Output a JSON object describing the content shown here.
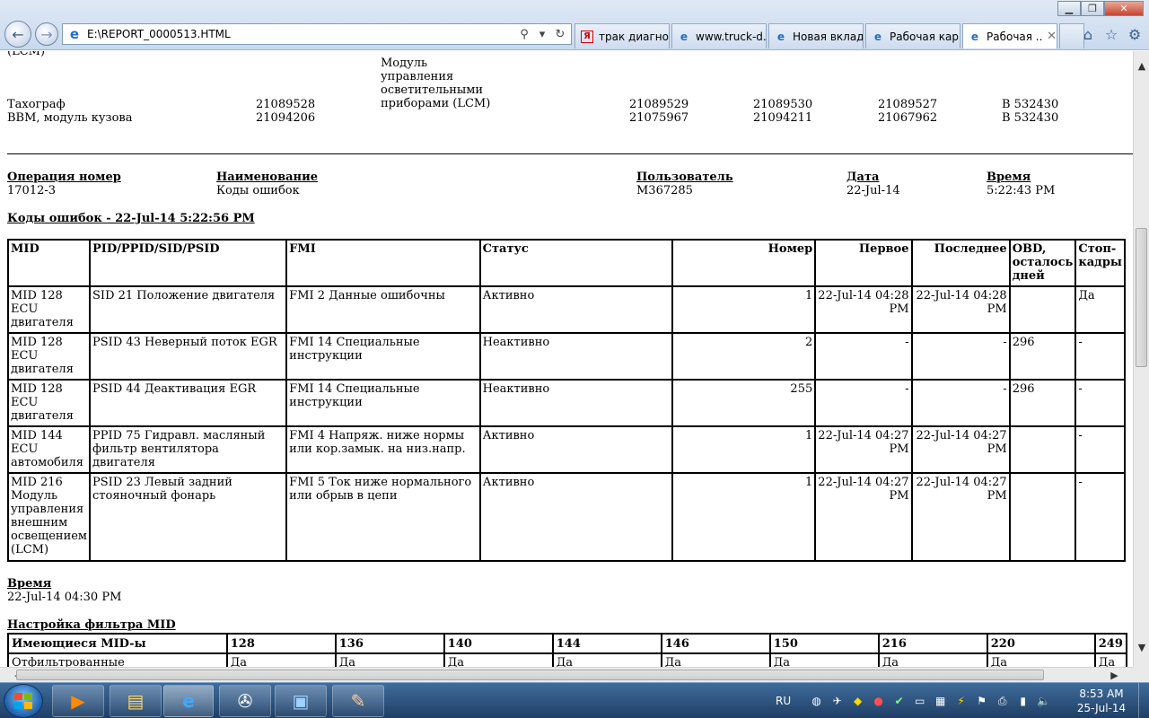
{
  "browser": {
    "address": "E:\\REPORT_0000513.HTML",
    "tabs": [
      {
        "label": "трак диагно...",
        "icon": "yandex-icon",
        "active": false
      },
      {
        "label": "www.truck-d...",
        "icon": "ie-icon",
        "active": false
      },
      {
        "label": "Новая вклад...",
        "icon": "ie-icon",
        "active": false
      },
      {
        "label": "Рабочая кар...",
        "icon": "ie-icon",
        "active": false
      },
      {
        "label": "Рабочая ...",
        "icon": "ie-icon",
        "active": true
      }
    ]
  },
  "report": {
    "lcm_continuation": "(LCM)",
    "lcm_description": "Модуль управления осветительными приборами (LCM)",
    "components": [
      {
        "name": "Тахограф",
        "part": "21089528",
        "c1": "21089529",
        "c2": "21089530",
        "c3": "21089527",
        "c4": "B 532430"
      },
      {
        "name": "BBM, модуль кузова",
        "part": "21094206",
        "c1": "21075967",
        "c2": "21094211",
        "c3": "21067962",
        "c4": "B 532430"
      }
    ],
    "operation": {
      "labels": {
        "number": "Операция номер",
        "name": "Наименование",
        "user": "Пользователь",
        "date": "Дата",
        "time": "Время"
      },
      "values": {
        "number": "17012-3",
        "name": "Коды ошибок",
        "user": "M367285",
        "date": "22-Jul-14",
        "time": "5:22:43 PM"
      }
    },
    "dtc_title": "Коды ошибок - 22-Jul-14 5:22:56 PM",
    "dtc_headers": [
      "MID",
      "PID/PPID/SID/PSID",
      "FMI",
      "Статус",
      "Номер",
      "Первое",
      "Последнее",
      "OBD, осталось дней",
      "Стоп-кадры"
    ],
    "dtc_rows": [
      {
        "mid": "MID 128 ECU двигателя",
        "pid": "SID 21 Положение двигателя",
        "fmi": "FMI 2 Данные ошибочны",
        "status": "Активно",
        "count": "1",
        "first": "22-Jul-14 04:28 PM",
        "last": "22-Jul-14 04:28 PM",
        "obd": "",
        "freeze": "Да"
      },
      {
        "mid": "MID 128 ECU двигателя",
        "pid": "PSID 43 Неверный поток EGR",
        "fmi": "FMI 14 Специальные инструкции",
        "status": "Неактивно",
        "count": "2",
        "first": "-",
        "last": "-",
        "obd": "296",
        "freeze": "-"
      },
      {
        "mid": "MID 128 ECU двигателя",
        "pid": "PSID 44 Деактивация EGR",
        "fmi": "FMI 14 Специальные инструкции",
        "status": "Неактивно",
        "count": "255",
        "first": "-",
        "last": "-",
        "obd": "296",
        "freeze": "-"
      },
      {
        "mid": "MID 144 ECU автомобиля",
        "pid": "PPID 75 Гидравл. масляный фильтр вентилятора двигателя",
        "fmi": "FMI 4 Напряж. ниже нормы или кор.замык. на низ.напр.",
        "status": "Активно",
        "count": "1",
        "first": "22-Jul-14 04:27 PM",
        "last": "22-Jul-14 04:27 PM",
        "obd": "",
        "freeze": "-"
      },
      {
        "mid": "MID 216 Модуль управления внешним освещением (LCM)",
        "pid": "PSID 23 Левый задний стояночный фонарь",
        "fmi": "FMI 5 Ток ниже нормального или обрыв в цепи",
        "status": "Активно",
        "count": "1",
        "first": "22-Jul-14 04:27 PM",
        "last": "22-Jul-14 04:27 PM",
        "obd": "",
        "freeze": "-"
      }
    ],
    "time_section": {
      "label": "Время",
      "value": "22-Jul-14 04:30 PM"
    },
    "mid_filter": {
      "title": "Настройка фильтра MID",
      "row1_label": "Имеющиеся MID-ы",
      "mids": [
        "128",
        "136",
        "140",
        "144",
        "146",
        "150",
        "216",
        "220",
        "249"
      ],
      "row2_label": "Отфильтрованные",
      "values": [
        "Да",
        "Да",
        "Да",
        "Да",
        "Да",
        "Да",
        "Да",
        "Да",
        "Да"
      ]
    }
  },
  "taskbar": {
    "lang": "RU",
    "time": "8:53 AM",
    "date": "25-Jul-14"
  }
}
